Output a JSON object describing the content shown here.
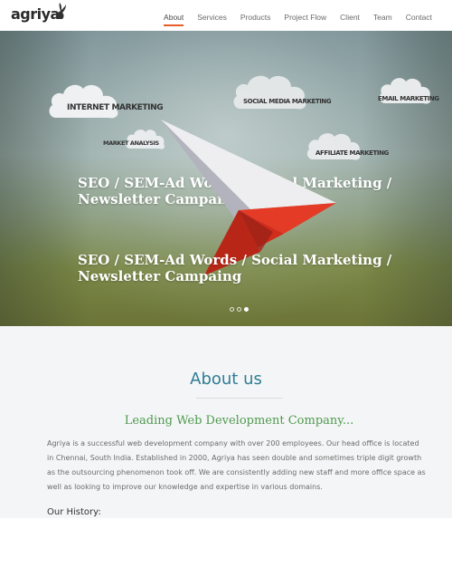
{
  "brand": {
    "name": "agriya"
  },
  "nav": {
    "items": [
      {
        "label": "About",
        "active": true
      },
      {
        "label": "Services",
        "active": false
      },
      {
        "label": "Products",
        "active": false
      },
      {
        "label": "Project Flow",
        "active": false
      },
      {
        "label": "Client",
        "active": false
      },
      {
        "label": "Team",
        "active": false
      },
      {
        "label": "Contact",
        "active": false
      }
    ],
    "accent_color": "#e85b2a"
  },
  "hero": {
    "clouds": [
      {
        "label": "Internet Marketing"
      },
      {
        "label": "Social Media Marketing"
      },
      {
        "label": "Email Marketing"
      },
      {
        "label": "Market Analysis"
      },
      {
        "label": "Affiliate Marketing"
      }
    ],
    "slides": [
      {
        "text": "SEO / SEM-Ad Words / Social Marketing / Newsletter Campaing"
      },
      {
        "text": "SEO / SEM-Ad Words / Social Marketing / Newsletter Campaing"
      }
    ],
    "slider": {
      "count": 3,
      "active_index": 2
    },
    "plane_colors": {
      "red": "#d9301e",
      "white": "#f2f2f4"
    }
  },
  "about": {
    "title": "About us",
    "subtitle": "Leading Web Development Company...",
    "body": "Agriya is a successful web development company with over 200 employees. Our head office is located in Chennai, South India. Established in 2000, Agriya has seen double and sometimes triple digit growth as the outsourcing phenomenon took off. We are consistently adding new staff and more office space as well as looking to improve our knowledge and expertise in various domains.",
    "history_heading": "Our History:",
    "title_color": "#2e7d97",
    "subtitle_color": "#4f9a4f"
  }
}
